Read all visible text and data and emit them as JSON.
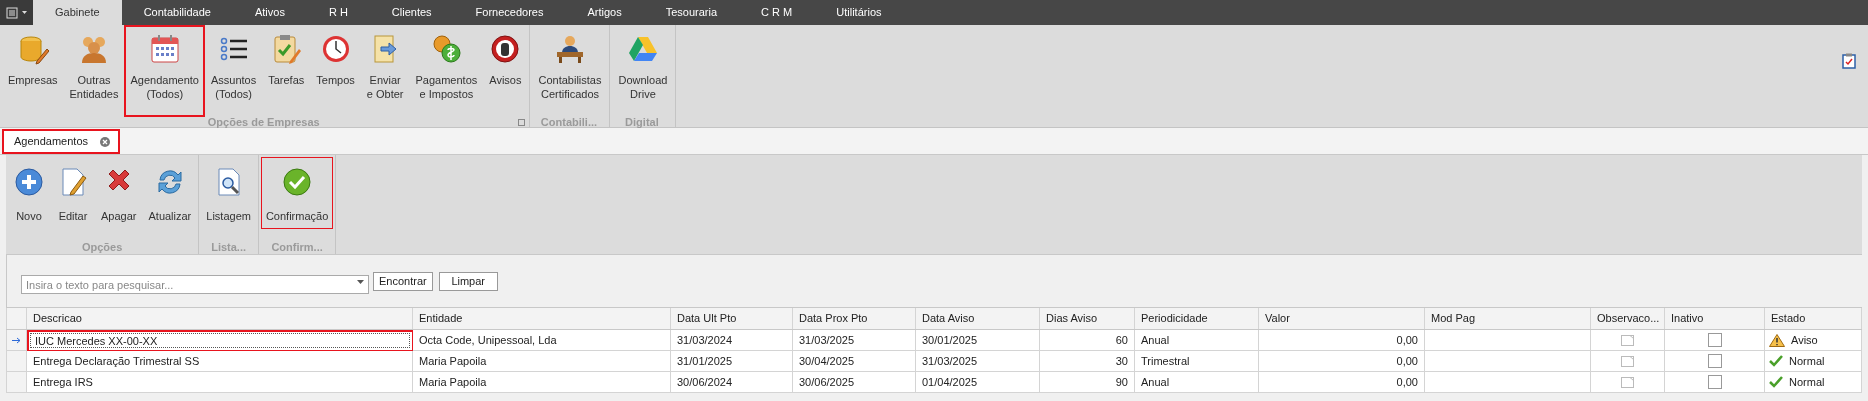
{
  "menu": {
    "tabs": [
      {
        "label": "Gabinete",
        "selected": true
      },
      {
        "label": "Contabilidade",
        "selected": false
      },
      {
        "label": "Ativos",
        "selected": false
      },
      {
        "label": "R H",
        "selected": false
      },
      {
        "label": "Clientes",
        "selected": false
      },
      {
        "label": "Fornecedores",
        "selected": false
      },
      {
        "label": "Artigos",
        "selected": false
      },
      {
        "label": "Tesouraria",
        "selected": false
      },
      {
        "label": "C R M",
        "selected": false
      },
      {
        "label": "Utilitários",
        "selected": false
      }
    ]
  },
  "ribbon": {
    "groups": [
      {
        "label": "Opções de Empresas",
        "expander": true,
        "buttons": [
          {
            "label": "Empresas",
            "kind": "database",
            "highlighted": false
          },
          {
            "label": "Outras\nEntidades",
            "kind": "people",
            "highlighted": false
          },
          {
            "label": "Agendamento\n(Todos)",
            "kind": "calendar",
            "highlighted": true
          },
          {
            "label": "Assuntos\n(Todos)",
            "kind": "list",
            "highlighted": false
          },
          {
            "label": "Tarefas",
            "kind": "clipboard",
            "highlighted": false
          },
          {
            "label": "Tempos",
            "kind": "clock",
            "highlighted": false
          },
          {
            "label": "Enviar\ne Obter",
            "kind": "export",
            "highlighted": false
          },
          {
            "label": "Pagamentos\ne Impostos",
            "kind": "coins",
            "highlighted": false
          },
          {
            "label": "Avisos",
            "kind": "stop",
            "highlighted": false
          }
        ]
      },
      {
        "label": "Contabili...",
        "expander": false,
        "buttons": [
          {
            "label": "Contabilistas\nCertificados",
            "kind": "desk",
            "highlighted": false
          }
        ]
      },
      {
        "label": "Digital",
        "expander": false,
        "buttons": [
          {
            "label": "Download\nDrive",
            "kind": "drive",
            "highlighted": false
          }
        ]
      }
    ]
  },
  "document_tabs": [
    {
      "label": "Agendamentos",
      "selected": true,
      "highlighted": true
    }
  ],
  "toolbar": {
    "groups": [
      {
        "label": "Opções",
        "buttons": [
          {
            "label": "Novo",
            "kind": "plus",
            "highlighted": false
          },
          {
            "label": "Editar",
            "kind": "edit",
            "highlighted": false
          },
          {
            "label": "Apagar",
            "kind": "delete",
            "highlighted": false
          },
          {
            "label": "Atualizar",
            "kind": "refresh",
            "highlighted": false
          }
        ]
      },
      {
        "label": "Lista...",
        "buttons": [
          {
            "label": "Listagem",
            "kind": "preview",
            "highlighted": false
          }
        ]
      },
      {
        "label": "Confirm...",
        "buttons": [
          {
            "label": "Confirmação",
            "kind": "confirm",
            "highlighted": true
          }
        ]
      }
    ]
  },
  "search": {
    "placeholder": "Insira o texto para pesquisar...",
    "buttons": [
      "Encontrar",
      "Limpar"
    ]
  },
  "table": {
    "columns": [
      {
        "label": "Descricao",
        "kind": "text"
      },
      {
        "label": "Entidade",
        "kind": "text"
      },
      {
        "label": "Data Ult Pto",
        "kind": "text"
      },
      {
        "label": "Data Prox Pto",
        "kind": "text"
      },
      {
        "label": "Data Aviso",
        "kind": "text"
      },
      {
        "label": "Dias Aviso",
        "kind": "number"
      },
      {
        "label": "Periodicidade",
        "kind": "text"
      },
      {
        "label": "Valor",
        "kind": "number"
      },
      {
        "label": "Mod Pag",
        "kind": "text"
      },
      {
        "label": "Observaco...",
        "kind": "note"
      },
      {
        "label": "Inativo",
        "kind": "check"
      },
      {
        "label": "Estado",
        "kind": "status"
      }
    ],
    "rows": [
      {
        "current": true,
        "cells": [
          "IUC Mercedes XX-00-XX",
          "Octa Code, Unipessoal, Lda",
          "31/03/2024",
          "31/03/2025",
          "30/01/2025",
          "60",
          "Anual",
          "0,00"
        ],
        "inactive": false,
        "status": {
          "kind": "warning",
          "label": "Aviso"
        }
      },
      {
        "current": false,
        "cells": [
          "Entrega Declaração Trimestral SS",
          "Maria Papoila",
          "31/01/2025",
          "30/04/2025",
          "31/03/2025",
          "30",
          "Trimestral",
          "0,00"
        ],
        "inactive": false,
        "status": {
          "kind": "normal",
          "label": "Normal"
        }
      },
      {
        "current": false,
        "cells": [
          "Entrega IRS",
          "Maria Papoila",
          "30/06/2024",
          "30/06/2025",
          "01/04/2025",
          "90",
          "Anual",
          "0,00"
        ],
        "inactive": false,
        "status": {
          "kind": "normal",
          "label": "Normal"
        }
      }
    ]
  }
}
